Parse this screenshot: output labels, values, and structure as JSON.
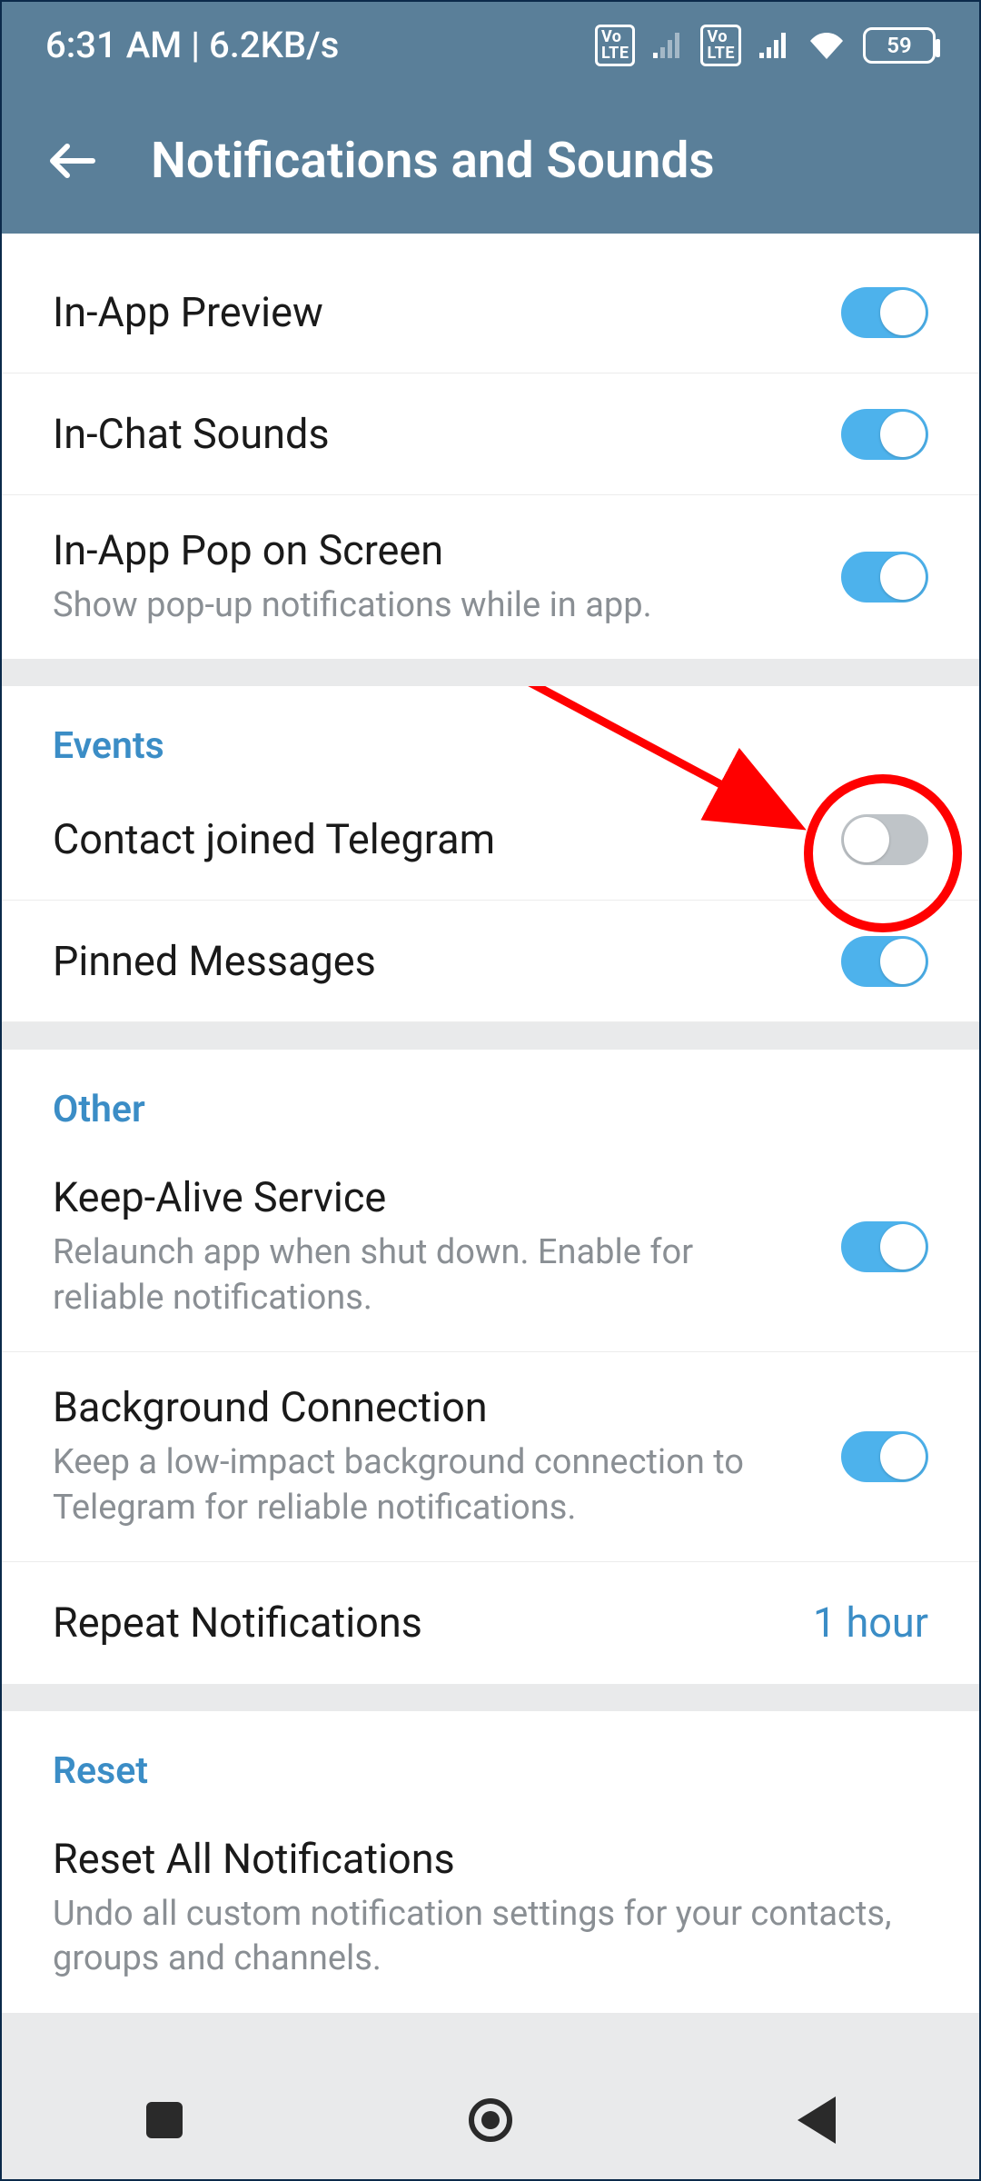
{
  "statusbar": {
    "time_net": "6:31 AM | 6.2KB/s",
    "battery": "59"
  },
  "header": {
    "title": "Notifications and Sounds"
  },
  "groups": {
    "g0": {
      "in_app_preview": "In-App Preview",
      "in_chat_sounds": "In-Chat Sounds",
      "in_app_pop": "In-App Pop on Screen",
      "in_app_pop_sub": "Show pop-up notifications while in app."
    },
    "events": {
      "head": "Events",
      "contact_joined": "Contact joined Telegram",
      "pinned": "Pinned Messages"
    },
    "other": {
      "head": "Other",
      "keep_alive": "Keep-Alive Service",
      "keep_alive_sub": "Relaunch app when shut down. Enable for reliable notifications.",
      "bg_conn": "Background Connection",
      "bg_conn_sub": "Keep a low-impact background connection to Telegram for reliable notifications.",
      "repeat": "Repeat Notifications",
      "repeat_value": "1 hour"
    },
    "reset": {
      "head": "Reset",
      "reset_all": "Reset All Notifications",
      "reset_all_sub": "Undo all custom notification settings for your contacts, groups and channels."
    }
  },
  "toggles": {
    "in_app_preview": true,
    "in_chat_sounds": true,
    "in_app_pop": true,
    "contact_joined": false,
    "pinned": true,
    "keep_alive": true,
    "bg_conn": true
  },
  "annotation": {
    "target": "contact-joined-toggle",
    "stroke": "#ff0000"
  }
}
